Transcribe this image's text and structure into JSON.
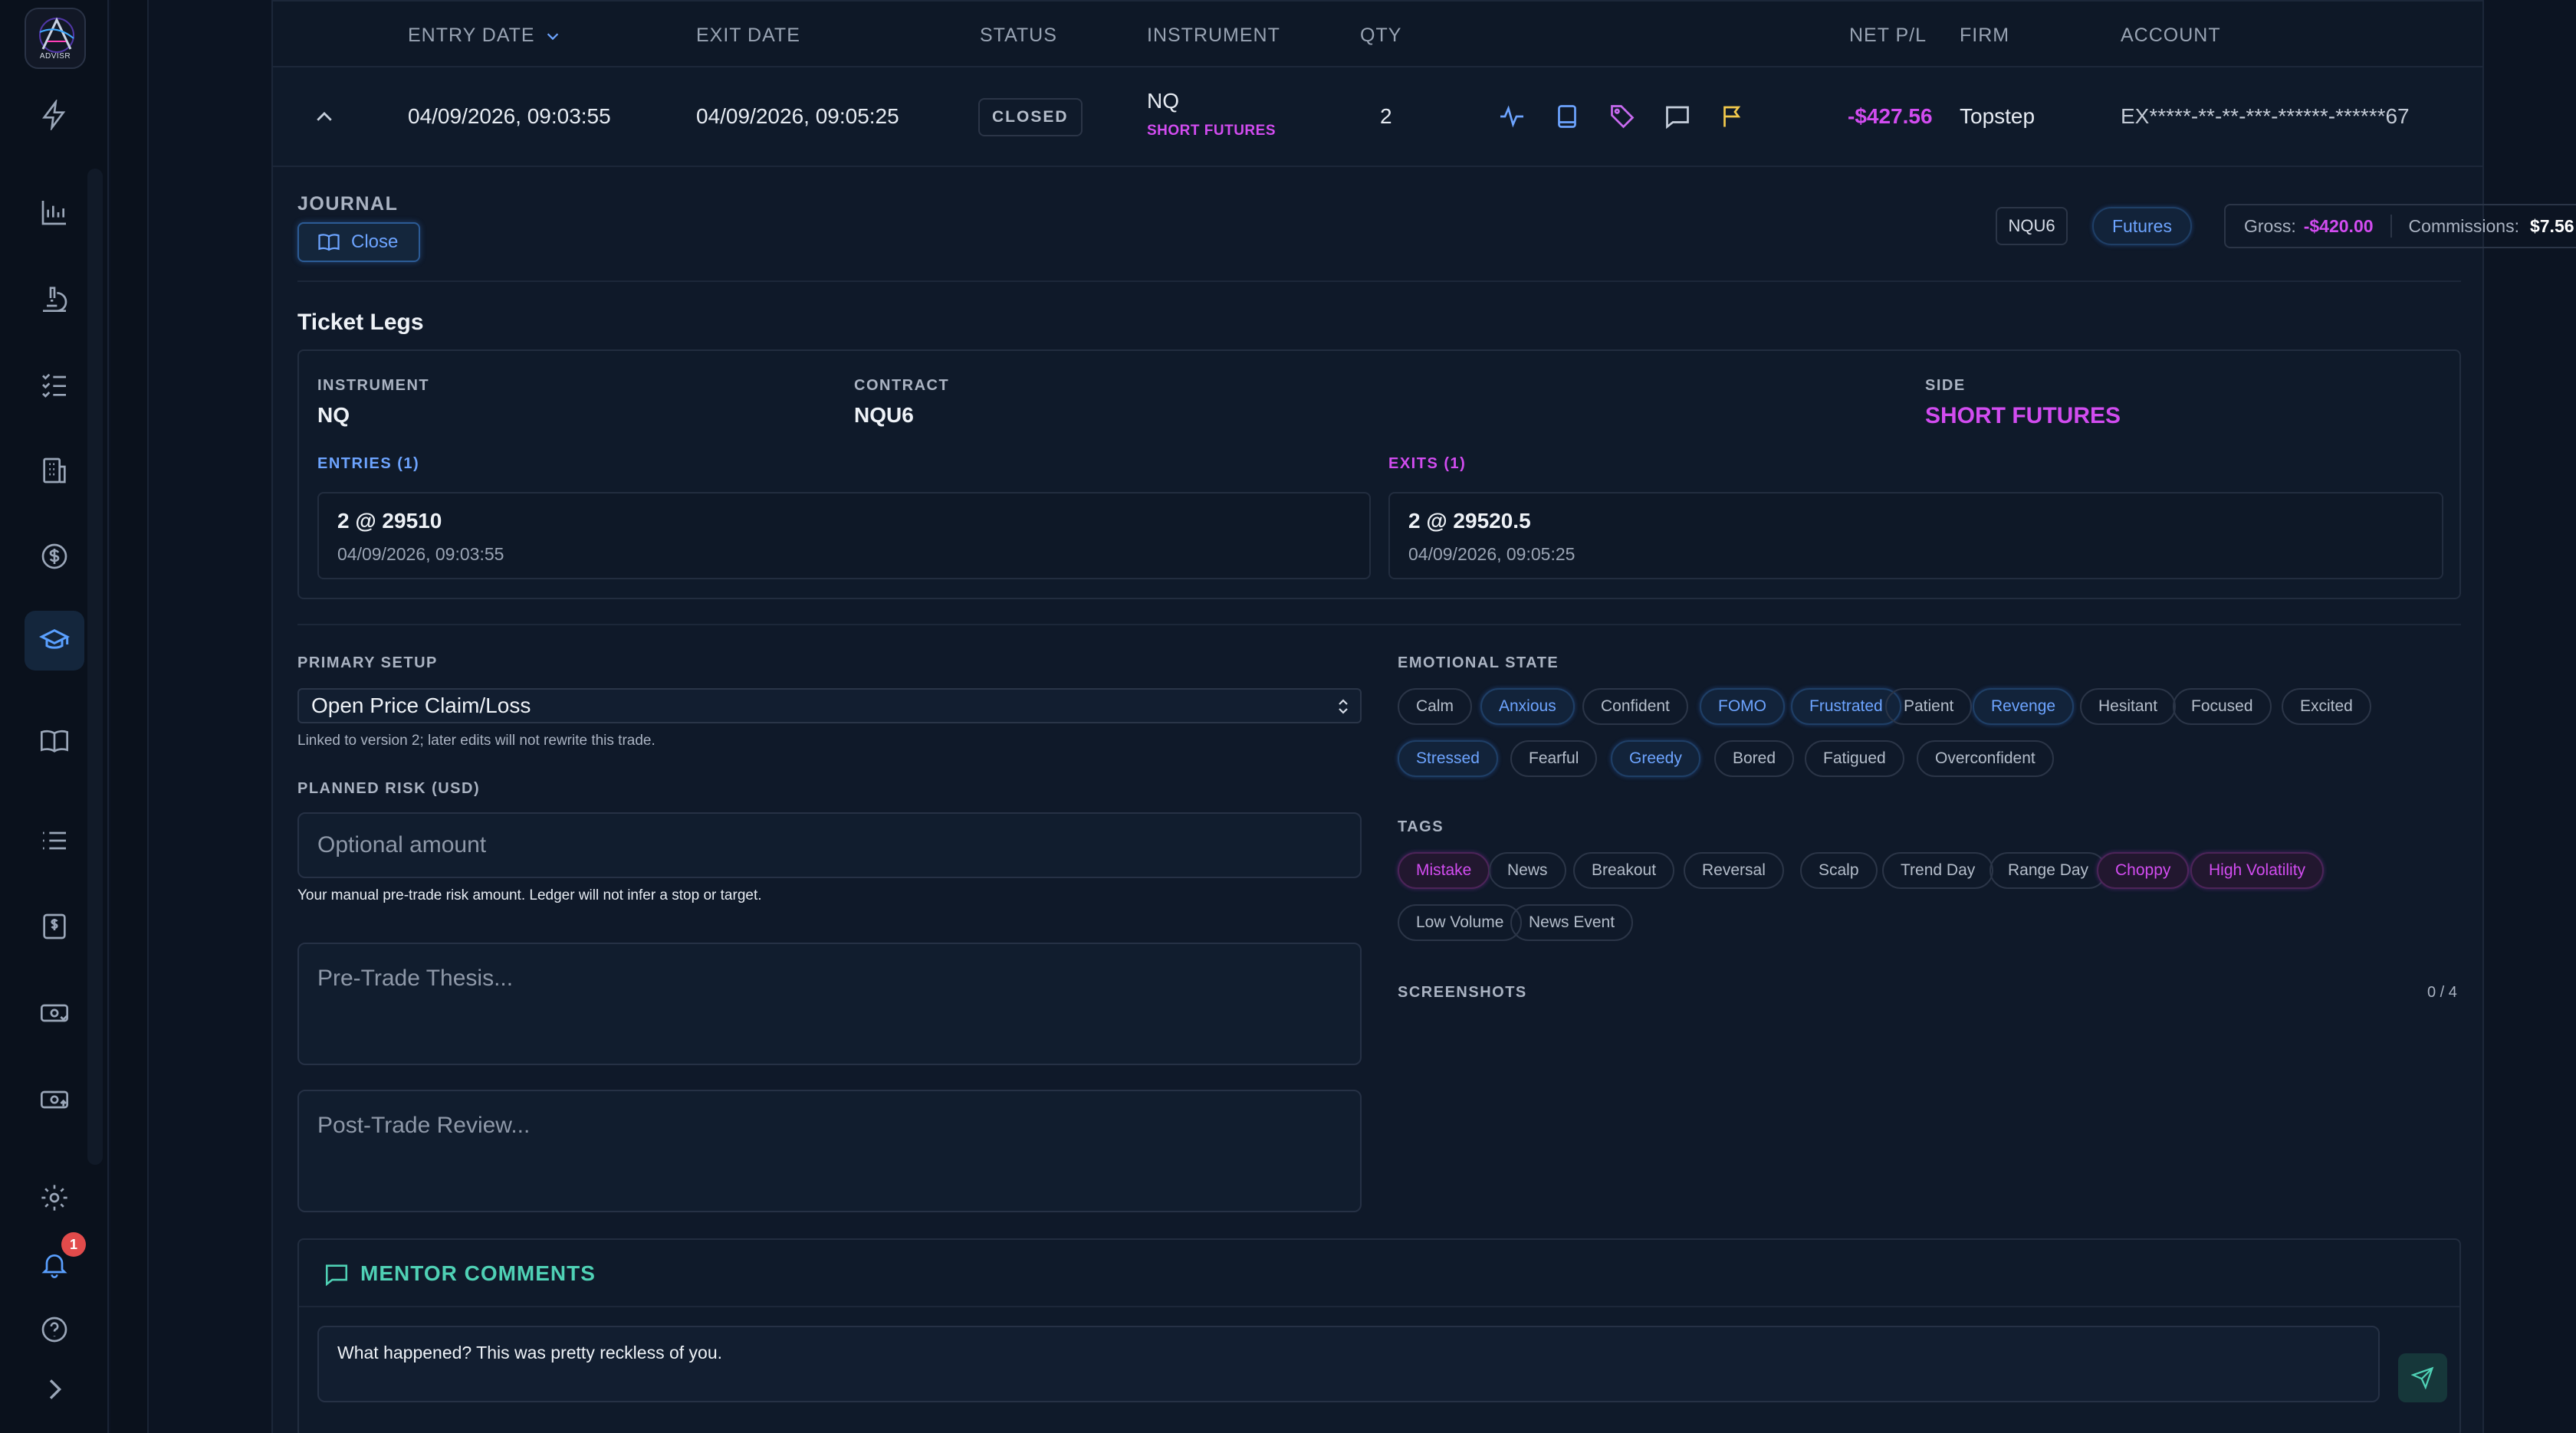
{
  "sidebar": {
    "logo_text": "ADVISR",
    "notification_count": "1",
    "items": [
      {
        "name": "bolt-icon"
      },
      {
        "name": "chart-icon"
      },
      {
        "name": "microscope-icon"
      },
      {
        "name": "checklist-icon"
      },
      {
        "name": "building-icon"
      },
      {
        "name": "dollar-icon"
      },
      {
        "name": "graduation-cap-icon"
      },
      {
        "name": "book-icon"
      },
      {
        "name": "list-icon"
      },
      {
        "name": "invoice-icon"
      },
      {
        "name": "payout-icon"
      },
      {
        "name": "cash-up-icon"
      },
      {
        "name": "gear-icon"
      },
      {
        "name": "bell-icon"
      },
      {
        "name": "help-icon"
      },
      {
        "name": "chevron-right-icon"
      }
    ],
    "active_item": "graduation-cap-icon"
  },
  "table": {
    "headers": {
      "entry_date": "ENTRY DATE",
      "exit_date": "EXIT DATE",
      "status": "STATUS",
      "instrument": "INSTRUMENT",
      "qty": "QTY",
      "net_pl": "NET P/L",
      "firm": "FIRM",
      "account": "ACCOUNT"
    },
    "row": {
      "entry_date": "04/09/2026, 09:03:55",
      "exit_date": "04/09/2026, 09:05:25",
      "status": "CLOSED",
      "instrument": "NQ",
      "instrument_side": "SHORT FUTURES",
      "qty": "2",
      "net_pl": "-$427.56",
      "firm": "Topstep",
      "account": "EX*****-**-**-***-******-******67"
    }
  },
  "journal": {
    "title": "JOURNAL",
    "close_label": "Close",
    "contract_badge": "NQU6",
    "type_badge": "Futures",
    "gross_label": "Gross:",
    "gross_value": "-$420.00",
    "commissions_label": "Commissions:",
    "commissions_value": "$7.56"
  },
  "ticket_legs": {
    "title": "Ticket Legs",
    "instrument_label": "INSTRUMENT",
    "instrument_value": "NQ",
    "contract_label": "CONTRACT",
    "contract_value": "NQU6",
    "side_label": "SIDE",
    "side_value": "SHORT FUTURES",
    "entries_label": "ENTRIES (1)",
    "entries": [
      {
        "fill": "2 @ 29510",
        "time": "04/09/2026, 09:03:55"
      }
    ],
    "exits_label": "EXITS (1)",
    "exits": [
      {
        "fill": "2 @ 29520.5",
        "time": "04/09/2026, 09:05:25"
      }
    ]
  },
  "form": {
    "primary_setup_label": "PRIMARY SETUP",
    "primary_setup_value": "Open Price Claim/Loss",
    "primary_setup_note": "Linked to version 2; later edits will not rewrite this trade.",
    "planned_risk_label": "PLANNED RISK (USD)",
    "planned_risk_placeholder": "Optional amount",
    "planned_risk_note": "Your manual pre-trade risk amount. Ledger will not infer a stop or target.",
    "thesis_placeholder": "Pre-Trade Thesis...",
    "review_placeholder": "Post-Trade Review..."
  },
  "emotional_state": {
    "label": "EMOTIONAL STATE",
    "options": [
      {
        "label": "Calm",
        "selected": false
      },
      {
        "label": "Anxious",
        "selected": true
      },
      {
        "label": "Confident",
        "selected": false
      },
      {
        "label": "FOMO",
        "selected": true
      },
      {
        "label": "Frustrated",
        "selected": true
      },
      {
        "label": "Patient",
        "selected": false
      },
      {
        "label": "Revenge",
        "selected": true
      },
      {
        "label": "Hesitant",
        "selected": false
      },
      {
        "label": "Focused",
        "selected": false
      },
      {
        "label": "Excited",
        "selected": false
      },
      {
        "label": "Stressed",
        "selected": true
      },
      {
        "label": "Fearful",
        "selected": false
      },
      {
        "label": "Greedy",
        "selected": true
      },
      {
        "label": "Bored",
        "selected": false
      },
      {
        "label": "Fatigued",
        "selected": false
      },
      {
        "label": "Overconfident",
        "selected": false
      }
    ]
  },
  "tags": {
    "label": "TAGS",
    "options": [
      {
        "label": "Mistake",
        "selected": true
      },
      {
        "label": "News",
        "selected": false
      },
      {
        "label": "Breakout",
        "selected": false
      },
      {
        "label": "Reversal",
        "selected": false
      },
      {
        "label": "Scalp",
        "selected": false
      },
      {
        "label": "Trend Day",
        "selected": false
      },
      {
        "label": "Range Day",
        "selected": false
      },
      {
        "label": "Choppy",
        "selected": true
      },
      {
        "label": "High Volatility",
        "selected": true
      },
      {
        "label": "Low Volume",
        "selected": false
      },
      {
        "label": "News Event",
        "selected": false
      }
    ]
  },
  "screenshots": {
    "label": "SCREENSHOTS",
    "count": "0 / 4"
  },
  "mentor": {
    "title": "MENTOR COMMENTS",
    "comment": "What happened? This was pretty reckless of you."
  },
  "colors": {
    "accent_blue": "#6da4ff",
    "accent_pink": "#d24cf0",
    "loss": "#d24cf0",
    "mentor_teal": "#4fd1b5",
    "flag_yellow": "#f2c94c"
  }
}
